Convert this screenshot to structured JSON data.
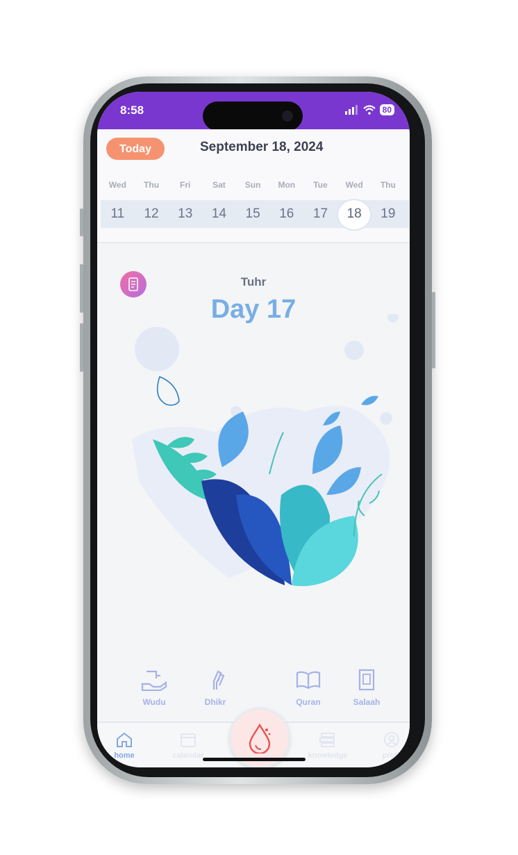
{
  "status_bar": {
    "time": "8:58",
    "battery": "80"
  },
  "header": {
    "today_label": "Today",
    "date_title": "September 18, 2024",
    "weekdays": [
      "Wed",
      "Thu",
      "Fri",
      "Sat",
      "Sun",
      "Mon",
      "Tue",
      "Wed",
      "Thu"
    ],
    "days": [
      "11",
      "12",
      "13",
      "14",
      "15",
      "16",
      "17",
      "18",
      "19"
    ],
    "selected_day": "18"
  },
  "cycle": {
    "phase": "Tuhr",
    "day_label": "Day 17"
  },
  "quick_actions": [
    {
      "label": "Wudu",
      "icon": "hand-water-icon"
    },
    {
      "label": "Dhikr",
      "icon": "prayer-hands-icon"
    },
    {
      "label": "Quran",
      "icon": "open-book-icon"
    },
    {
      "label": "Salaah",
      "icon": "prayer-mat-icon"
    }
  ],
  "tabs": [
    {
      "label": "home",
      "icon": "home-icon",
      "active": true
    },
    {
      "label": "calendar",
      "icon": "calendar-icon"
    },
    {
      "label": "knowledge",
      "icon": "books-icon"
    },
    {
      "label": "profil",
      "icon": "profile-icon"
    }
  ],
  "colors": {
    "brand_purple": "#7a37cf",
    "today_orange": "#f59370",
    "accent_blue": "#78aee5"
  }
}
